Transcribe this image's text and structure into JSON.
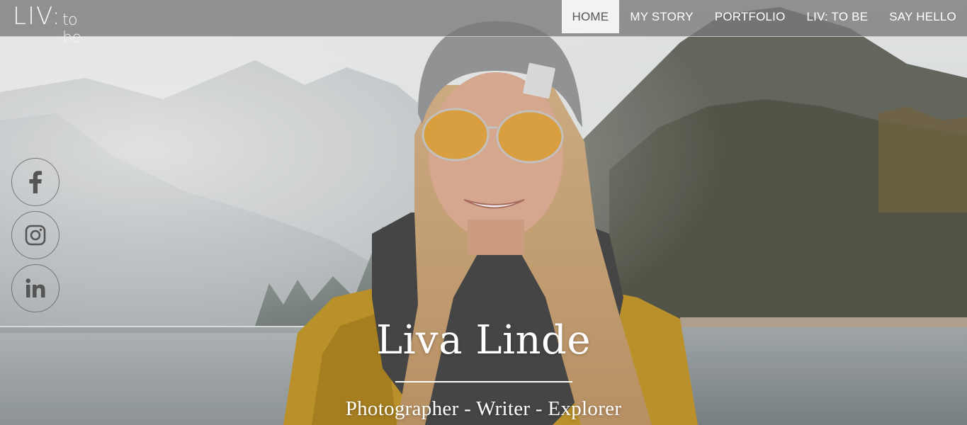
{
  "brand": {
    "logo_mark": "LIV:",
    "logo_text": "to be"
  },
  "nav": {
    "items": [
      {
        "label": "HOME",
        "active": true
      },
      {
        "label": "MY STORY",
        "active": false
      },
      {
        "label": "PORTFOLIO",
        "active": false
      },
      {
        "label": "LIV: TO BE",
        "active": false
      },
      {
        "label": "SAY HELLO",
        "active": false
      }
    ]
  },
  "social": [
    {
      "icon": "facebook-icon"
    },
    {
      "icon": "instagram-icon"
    },
    {
      "icon": "linkedin-icon"
    }
  ],
  "hero": {
    "name": "Liva Linde",
    "tagline": "Photographer - Writer - Explorer"
  },
  "colors": {
    "nav_bg": "#787878",
    "nav_active_bg": "#f2f2f2",
    "nav_active_text": "#555555",
    "text_light": "#ffffff",
    "jacket": "#c59a2c",
    "beanie": "#9a9c9e",
    "glasses": "#e8a83a"
  }
}
